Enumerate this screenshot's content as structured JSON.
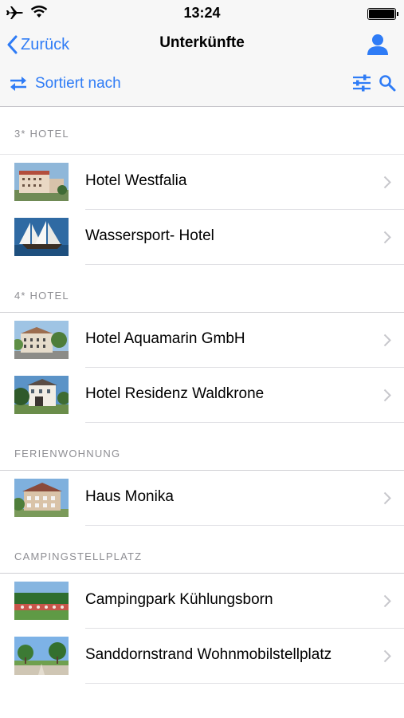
{
  "status": {
    "time": "13:24"
  },
  "nav": {
    "back_label": "Zurück",
    "title": "Unterkünfte"
  },
  "toolbar": {
    "sort_label": "Sortiert nach"
  },
  "sections": [
    {
      "header": "3* HOTEL",
      "items": [
        {
          "name": "Hotel Westfalia"
        },
        {
          "name": "Wassersport- Hotel"
        }
      ]
    },
    {
      "header": "4* HOTEL",
      "items": [
        {
          "name": "Hotel Aquamarin GmbH"
        },
        {
          "name": "Hotel Residenz Waldkrone"
        }
      ]
    },
    {
      "header": "FERIENWOHNUNG",
      "items": [
        {
          "name": "Haus Monika"
        }
      ]
    },
    {
      "header": "CAMPINGSTELLPLATZ",
      "items": [
        {
          "name": "Campingpark Kühlungsborn"
        },
        {
          "name": "Sanddornstrand Wohnmobilstellplatz"
        }
      ]
    }
  ],
  "colors": {
    "accent": "#2f7cf6",
    "background": "#efeff4",
    "separator": "#c8c7cc"
  },
  "icons": [
    "airplane-icon",
    "wifi-icon",
    "battery-icon",
    "back-chevron-icon",
    "user-icon",
    "sort-arrows-icon",
    "filter-sliders-icon",
    "search-icon",
    "chevron-right-icon"
  ]
}
